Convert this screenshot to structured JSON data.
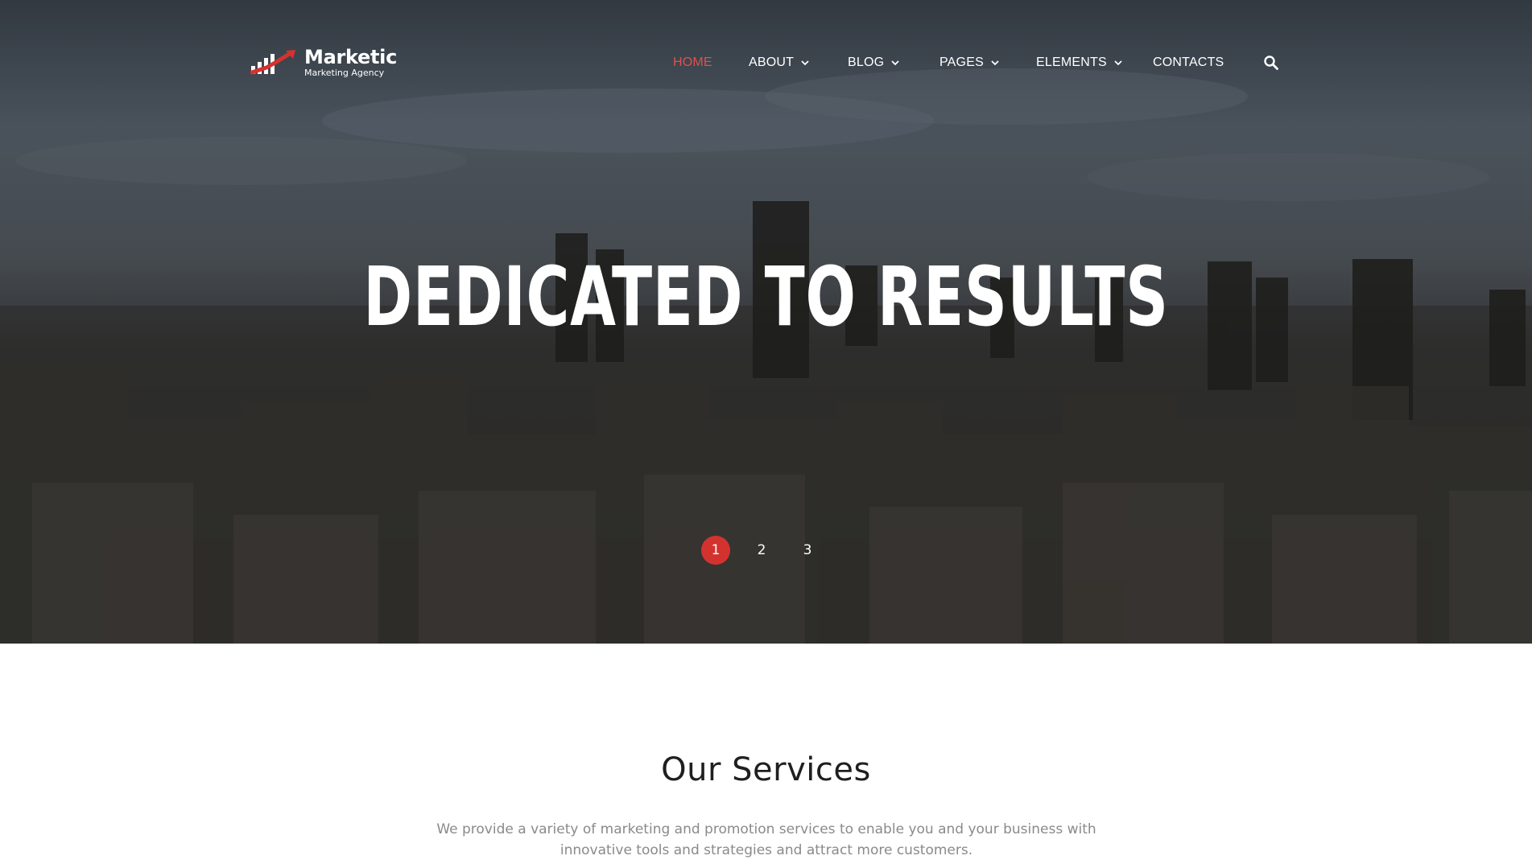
{
  "brand": {
    "name": "Marketic",
    "tagline": "Marketing Agency",
    "accent_color": "#d4322f"
  },
  "nav": {
    "items": [
      {
        "label": "Home",
        "active": true
      },
      {
        "label": "About",
        "dropdown": true
      },
      {
        "label": "Blog",
        "dropdown": true
      },
      {
        "label": "Pages",
        "dropdown": true
      },
      {
        "label": "Elements",
        "dropdown": true
      },
      {
        "label": "Contacts"
      }
    ],
    "search_icon": "search-icon"
  },
  "hero": {
    "title": "DEDICATED TO RESULTS",
    "slides": [
      "1",
      "2",
      "3"
    ],
    "active_slide": "1"
  },
  "services": {
    "title": "Our Services",
    "description": "We provide a variety of marketing and promotion services to enable you and your business with innovative tools and strategies and attract more customers."
  }
}
